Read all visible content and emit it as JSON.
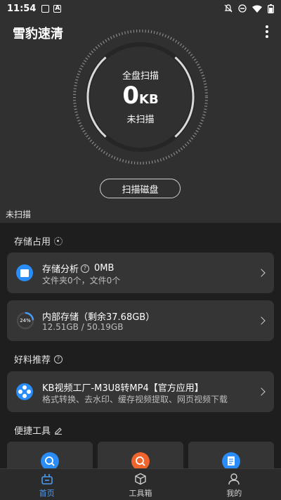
{
  "status_bar": {
    "time": "11:54",
    "badge_a": "A"
  },
  "header": {
    "title": "雪豹速清"
  },
  "gauge": {
    "label": "全盘扫描",
    "value": "0",
    "unit": "KB",
    "status": "未扫描"
  },
  "scan_button": {
    "label": "扫描磁盘"
  },
  "scan_status": "未扫描",
  "storage_section": {
    "title": "存储占用"
  },
  "storage_analysis": {
    "title": "存储分析",
    "value": "0MB",
    "subtitle": "文件夹0个，文件0个"
  },
  "internal_storage": {
    "title": "内部存储（剩余37.68GB）",
    "subtitle": "12.51GB / 50.19GB",
    "percent_label": "24%",
    "percent": 24
  },
  "recommend_section": {
    "title": "好料推荐"
  },
  "recommend_app": {
    "title": "KB视频工厂-M3U8转MP4【官方应用】",
    "subtitle": "格式转换、去水印、缓存视频提取、网页视频下载"
  },
  "tools_section": {
    "title": "便捷工具"
  },
  "bottom_nav": {
    "items": [
      {
        "label": "首页"
      },
      {
        "label": "工具箱"
      },
      {
        "label": "我的"
      }
    ]
  },
  "colors": {
    "accent": "#4a9cf5",
    "app_blue": "#2a8df7",
    "tool_orange": "#f0642d",
    "background": "#1e1e1e",
    "header_bg": "#303030",
    "card_bg": "#353535"
  }
}
